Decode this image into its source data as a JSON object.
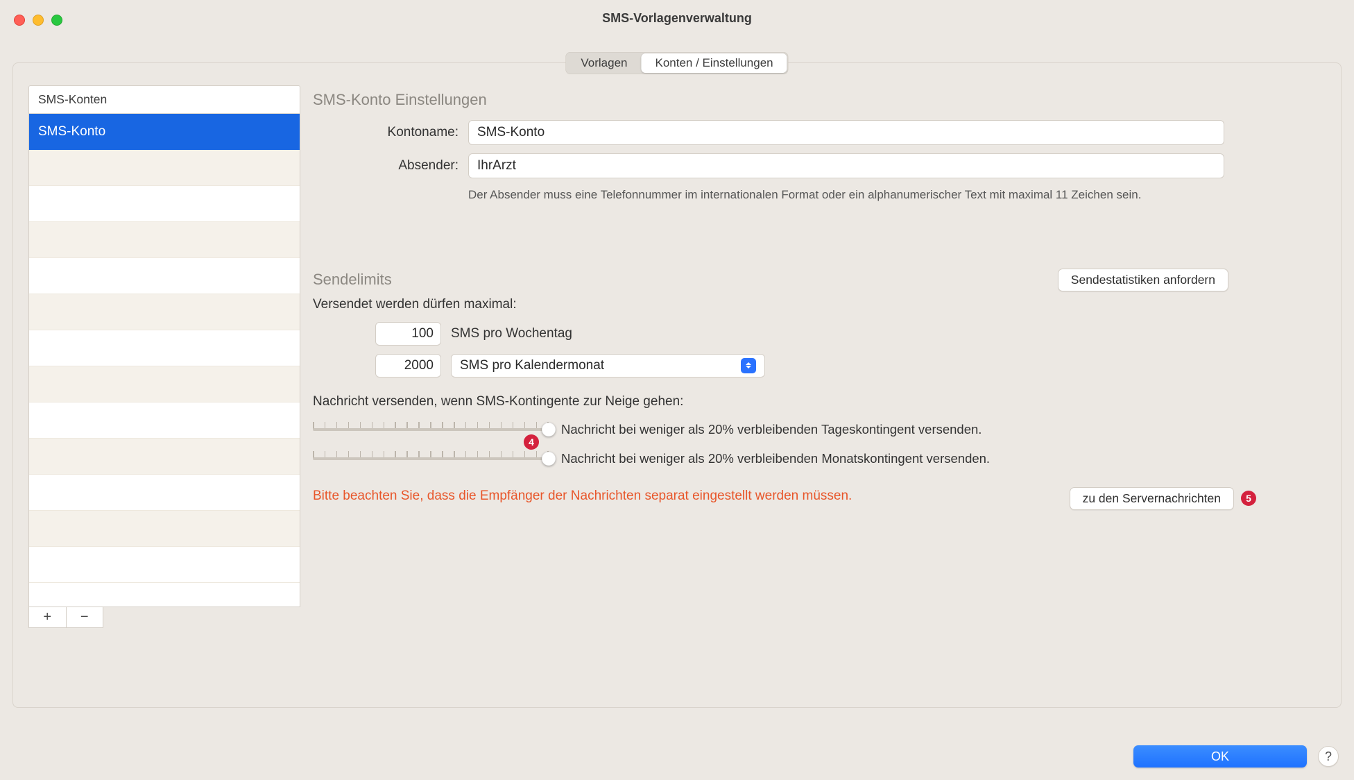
{
  "window": {
    "title": "SMS-Vorlagenverwaltung"
  },
  "tabs": {
    "templates": "Vorlagen",
    "accounts": "Konten / Einstellungen"
  },
  "sidebar": {
    "header": "SMS-Konten",
    "items": [
      {
        "label": "SMS-Konto"
      }
    ]
  },
  "buttons": {
    "add": "+",
    "remove": "−",
    "request_stats": "Sendestatistiken anfordern",
    "server_messages": "zu den Servernachrichten",
    "ok": "OK",
    "help": "?"
  },
  "account": {
    "section_title": "SMS-Konto Einstellungen",
    "name_label": "Kontoname:",
    "name_value": "SMS-Konto",
    "sender_label": "Absender:",
    "sender_value": "IhrArzt",
    "sender_hint": "Der Absender muss eine Telefonnummer im internationalen Format oder ein alphanumerischer Text mit maximal 11 Zeichen sein."
  },
  "limits": {
    "section_title": "Sendelimits",
    "intro": "Versendet werden dürfen maximal:",
    "per_weekday_value": "100",
    "per_weekday_label": "SMS pro Wochentag",
    "per_month_value": "2000",
    "per_month_select": "SMS pro Kalendermonat",
    "threshold_intro": "Nachricht versenden, wenn SMS-Kontingente zur Neige gehen:",
    "daily_msg": "Nachricht bei weniger als 20% verbleibenden Tageskontingent versenden.",
    "monthly_msg": "Nachricht bei weniger als 20% verbleibenden Monatskontingent versenden.",
    "warning": "Bitte beachten Sie, dass die Empfänger der Nachrichten separat eingestellt werden müssen."
  },
  "badges": {
    "b4": "4",
    "b5": "5"
  }
}
